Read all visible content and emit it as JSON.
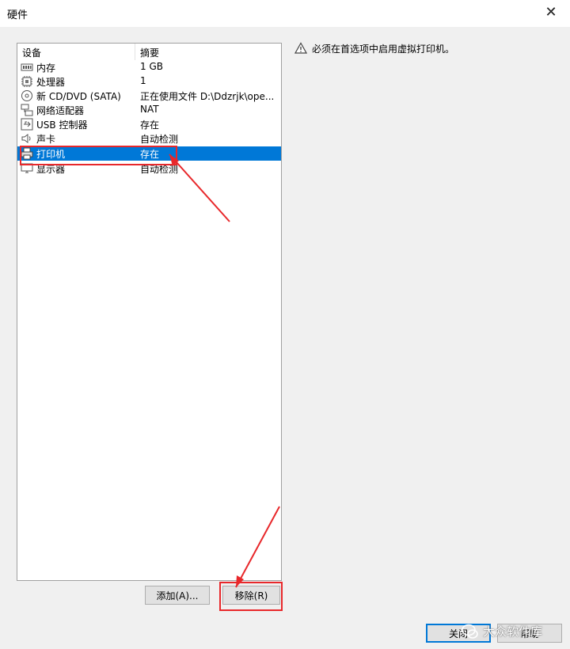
{
  "window": {
    "title": "硬件"
  },
  "table": {
    "headers": {
      "device": "设备",
      "summary": "摘要"
    },
    "rows": [
      {
        "icon": "memory-icon",
        "device": "内存",
        "summary": "1 GB"
      },
      {
        "icon": "cpu-icon",
        "device": "处理器",
        "summary": "1"
      },
      {
        "icon": "cd-dvd-icon",
        "device": "新 CD/DVD (SATA)",
        "summary": "正在使用文件 D:\\Ddzrjk\\ope..."
      },
      {
        "icon": "network-adapter-icon",
        "device": "网络适配器",
        "summary": "NAT"
      },
      {
        "icon": "usb-icon",
        "device": "USB 控制器",
        "summary": "存在"
      },
      {
        "icon": "speaker-icon",
        "device": "声卡",
        "summary": "自动检测"
      },
      {
        "icon": "printer-icon",
        "device": "打印机",
        "summary": "存在",
        "selected": true
      },
      {
        "icon": "display-icon",
        "device": "显示器",
        "summary": "自动检测"
      }
    ]
  },
  "info": {
    "icon": "warning-icon",
    "message": "必须在首选项中启用虚拟打印机。"
  },
  "buttons": {
    "add": "添加(A)...",
    "remove": "移除(R)",
    "close": "关闭",
    "help": "帮助"
  },
  "watermark": {
    "text": "大众软件库"
  },
  "colors": {
    "selection": "#0078d7",
    "annotation": "#e8282b"
  }
}
